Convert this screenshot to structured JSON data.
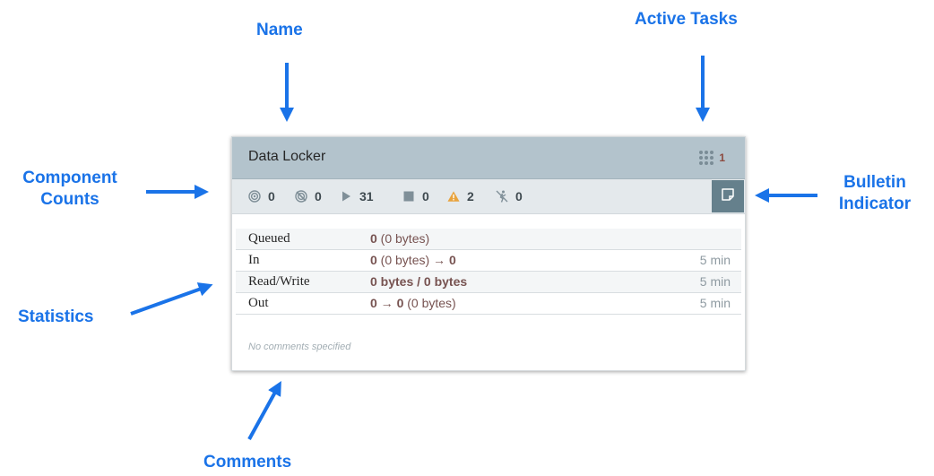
{
  "callouts": {
    "name": "Name",
    "active_tasks": "Active Tasks",
    "component_counts": "Component Counts",
    "bulletin_indicator": "Bulletin Indicator",
    "statistics": "Statistics",
    "comments": "Comments"
  },
  "group": {
    "name": "Data Locker",
    "active_tasks": "1",
    "counts": {
      "transmitting": "0",
      "not_transmitting": "0",
      "running": "31",
      "stopped": "0",
      "invalid": "2",
      "disabled": "0"
    },
    "stats": [
      {
        "label": "Queued",
        "value_bold": "0",
        "value_rest": " (0 bytes)",
        "time": ""
      },
      {
        "label": "In",
        "value_bold": "0",
        "value_rest": " (0 bytes) → ",
        "value_tail_bold": "0",
        "time": "5 min"
      },
      {
        "label": "Read/Write",
        "value_bold": "0 bytes / 0 bytes",
        "value_rest": "",
        "time": "5 min"
      },
      {
        "label": "Out",
        "value_bold": "0 → 0",
        "value_rest": " (0 bytes)",
        "time": "5 min"
      }
    ],
    "comments": "No comments specified"
  },
  "colors": {
    "callout": "#1a73e8",
    "header": "#b3c3cc",
    "counts_bar": "#e4e9ec",
    "bulletin": "#65808c",
    "stat_value": "#775351",
    "warning": "#e8a33d"
  },
  "icons": {
    "transmitting": "transmitting-icon",
    "not_transmitting": "not-transmitting-icon",
    "running": "play-icon",
    "stopped": "stop-icon",
    "invalid": "warning-icon",
    "disabled": "disabled-icon",
    "active_tasks": "tasks-grid-icon",
    "bulletin": "bulletin-icon"
  }
}
